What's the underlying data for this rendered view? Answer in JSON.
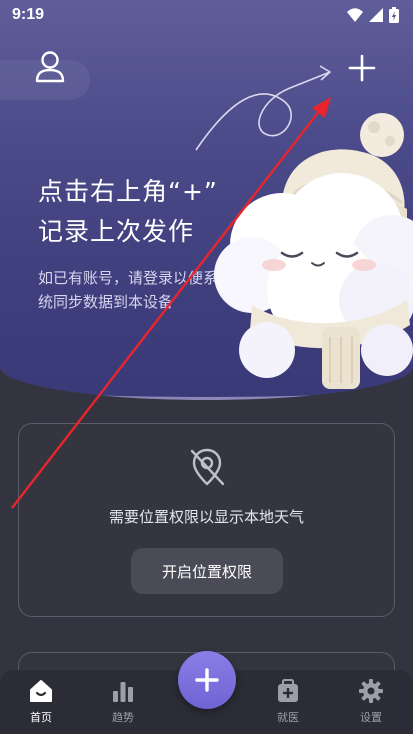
{
  "status_bar": {
    "time": "9:19",
    "icons": [
      "wifi-icon",
      "signal-icon",
      "battery-icon"
    ]
  },
  "hero": {
    "title_line1": "点击右上角“+”",
    "title_line2": "记录上次发作",
    "subtitle": "如已有账号，请登录以便系统同步数据到本设备",
    "icons": [
      "user-icon",
      "add-icon",
      "dashed-arrow-icon",
      "cloud-mascot-icon"
    ]
  },
  "location_card": {
    "icon": "location-off-icon",
    "message": "需要位置权限以显示本地天气",
    "button_label": "开启位置权限"
  },
  "tab_bar": {
    "items": [
      {
        "label": "首页",
        "icon": "home-icon",
        "active": true
      },
      {
        "label": "趋势",
        "icon": "bar-chart-icon",
        "active": false
      },
      {
        "label": "就医",
        "icon": "medical-kit-icon",
        "active": false
      },
      {
        "label": "设置",
        "icon": "gear-icon",
        "active": false
      }
    ],
    "fab_icon": "add-icon"
  },
  "colors": {
    "background": "#33343f",
    "hero_top": "#5f5e9a",
    "hero_bottom": "#3a3977",
    "accent": "#7b70dd",
    "annotation_arrow": "#e8252c"
  }
}
